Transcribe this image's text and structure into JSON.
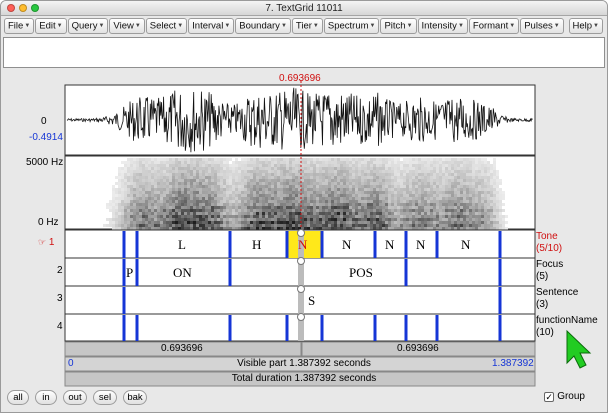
{
  "window": {
    "title": "7. TextGrid 11011"
  },
  "menu": {
    "items": [
      "File",
      "Edit",
      "Query",
      "View",
      "Select",
      "Interval",
      "Boundary",
      "Tier",
      "Spectrum",
      "Pitch",
      "Intensity",
      "Formant",
      "Pulses"
    ],
    "help": "Help"
  },
  "cursor": {
    "time": "0.693696"
  },
  "waveform": {
    "top_value": "0",
    "bottom_value": "-0.4914"
  },
  "spectrogram": {
    "max_label": "5000 Hz",
    "min_label": "0 Hz"
  },
  "tiers": [
    {
      "number": "1",
      "name": "Tone",
      "info": "(5/10)",
      "selected": true,
      "labels": [
        "L",
        "H",
        "N",
        "N",
        "N",
        "N",
        "N"
      ]
    },
    {
      "number": "2",
      "name": "Focus",
      "info": "(5)",
      "selected": false,
      "labels": [
        "P",
        "ON",
        "POS"
      ]
    },
    {
      "number": "3",
      "name": "Sentence",
      "info": "(3)",
      "selected": false,
      "labels": [
        "S"
      ]
    },
    {
      "number": "4",
      "name": "functionName",
      "info": "(10)",
      "selected": false,
      "labels": []
    }
  ],
  "time_segments": {
    "left": "0.693696",
    "right": "0.693696"
  },
  "visible": {
    "start": "0",
    "text": "Visible part 1.387392 seconds",
    "end": "1.387392"
  },
  "total": {
    "text": "Total duration 1.387392 seconds"
  },
  "buttons": {
    "all": "all",
    "in": "in",
    "out": "out",
    "sel": "sel",
    "bak": "bak"
  },
  "group": {
    "label": "Group",
    "checked": true
  },
  "colors": {
    "boundary": "#1535d6",
    "cursor": "#d01010",
    "selection": "#ffe81a",
    "pointer": "#22cc22"
  },
  "icons": {
    "tier_pointer": "pointing-hand-icon",
    "mouse_cursor": "arrow-cursor-icon"
  }
}
